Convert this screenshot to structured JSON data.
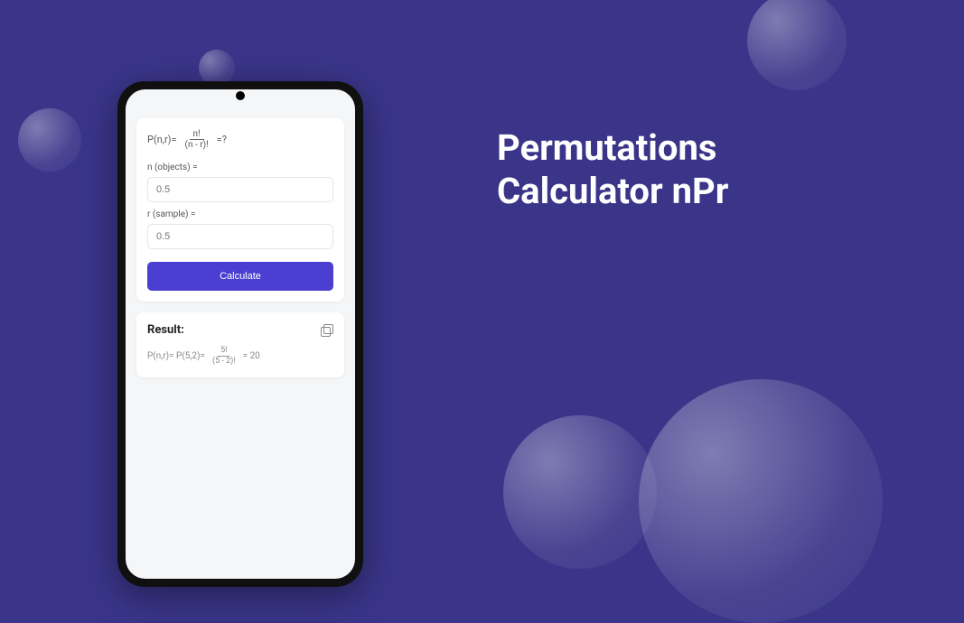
{
  "headline": {
    "line1": "Permutations",
    "line2": "Calculator nPr"
  },
  "app": {
    "formula": {
      "left": "P(n,r)=",
      "numerator": "n!",
      "denominator": "(n - r)!",
      "right": "=?"
    },
    "inputs": {
      "n_label": "n (objects) =",
      "n_placeholder": "0.5",
      "r_label": "r (sample) =",
      "r_placeholder": "0.5"
    },
    "calculate_label": "Calculate",
    "result": {
      "title": "Result:",
      "expr_left": "P(n,r)= P(5,2)=",
      "numerator": "5!",
      "denominator": "(5 - 2)!",
      "equals_value": "= 20"
    }
  },
  "colors": {
    "background": "#3a3589",
    "accent": "#4a3fd1"
  }
}
